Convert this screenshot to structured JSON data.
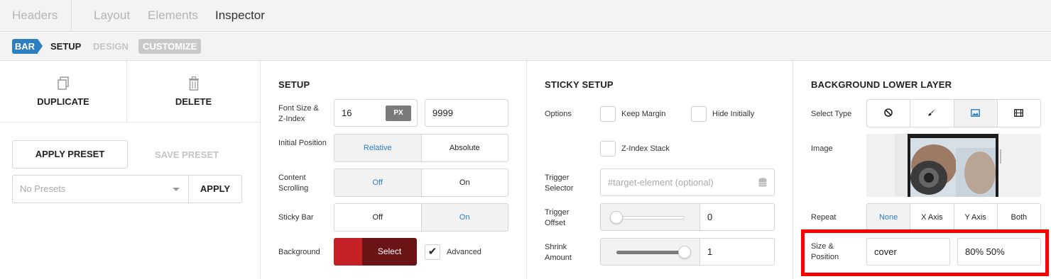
{
  "top_tabs": [
    {
      "label": "Headers",
      "active": false
    },
    {
      "label": "Layout",
      "active": false
    },
    {
      "label": "Elements",
      "active": false
    },
    {
      "label": "Inspector",
      "active": true
    }
  ],
  "breadcrumb": {
    "bar": "BAR",
    "setup": "SETUP",
    "design": "DESIGN",
    "customize": "CUSTOMIZE"
  },
  "left": {
    "duplicate": "DUPLICATE",
    "delete": "DELETE",
    "apply_preset": "APPLY PRESET",
    "save_preset": "SAVE PRESET",
    "presets_placeholder": "No Presets",
    "apply": "APPLY"
  },
  "setup": {
    "title": "SETUP",
    "font_size_label": "Font Size & Z-Index",
    "font_size": "16",
    "font_unit": "PX",
    "z_index": "9999",
    "initial_position_label": "Initial Position",
    "initial_position_options": [
      "Relative",
      "Absolute"
    ],
    "content_scrolling_label": "Content Scrolling",
    "content_scrolling_options": [
      "Off",
      "On"
    ],
    "sticky_bar_label": "Sticky Bar",
    "sticky_bar_options": [
      "Off",
      "On"
    ],
    "background_label": "Background",
    "background_select": "Select",
    "advanced_label": "Advanced",
    "swatch_colors": [
      "#c42126",
      "#6a1416"
    ]
  },
  "sticky": {
    "title": "STICKY SETUP",
    "options_label": "Options",
    "keep_margin": "Keep Margin",
    "hide_initially": "Hide Initially",
    "z_index_stack": "Z-Index Stack",
    "trigger_selector_label": "Trigger Selector",
    "trigger_selector_placeholder": "#target-element (optional)",
    "trigger_offset_label": "Trigger Offset",
    "trigger_offset_value": "0",
    "shrink_amount_label": "Shrink Amount",
    "shrink_amount_value": "1",
    "trigger_offset_level": 0.0,
    "shrink_amount_level": 1.0
  },
  "background": {
    "title": "BACKGROUND LOWER LAYER",
    "select_type_label": "Select Type",
    "type_icons": [
      "none-icon",
      "brush-icon",
      "image-icon",
      "video-icon"
    ],
    "image_label": "Image",
    "repeat_label": "Repeat",
    "repeat_options": [
      "None",
      "X Axis",
      "Y Axis",
      "Both"
    ],
    "size_position_label": "Size & Position",
    "size": "cover",
    "position": "80% 50%"
  },
  "colors": {
    "accent": "#2c7fc0",
    "highlight": "#ff0000"
  }
}
